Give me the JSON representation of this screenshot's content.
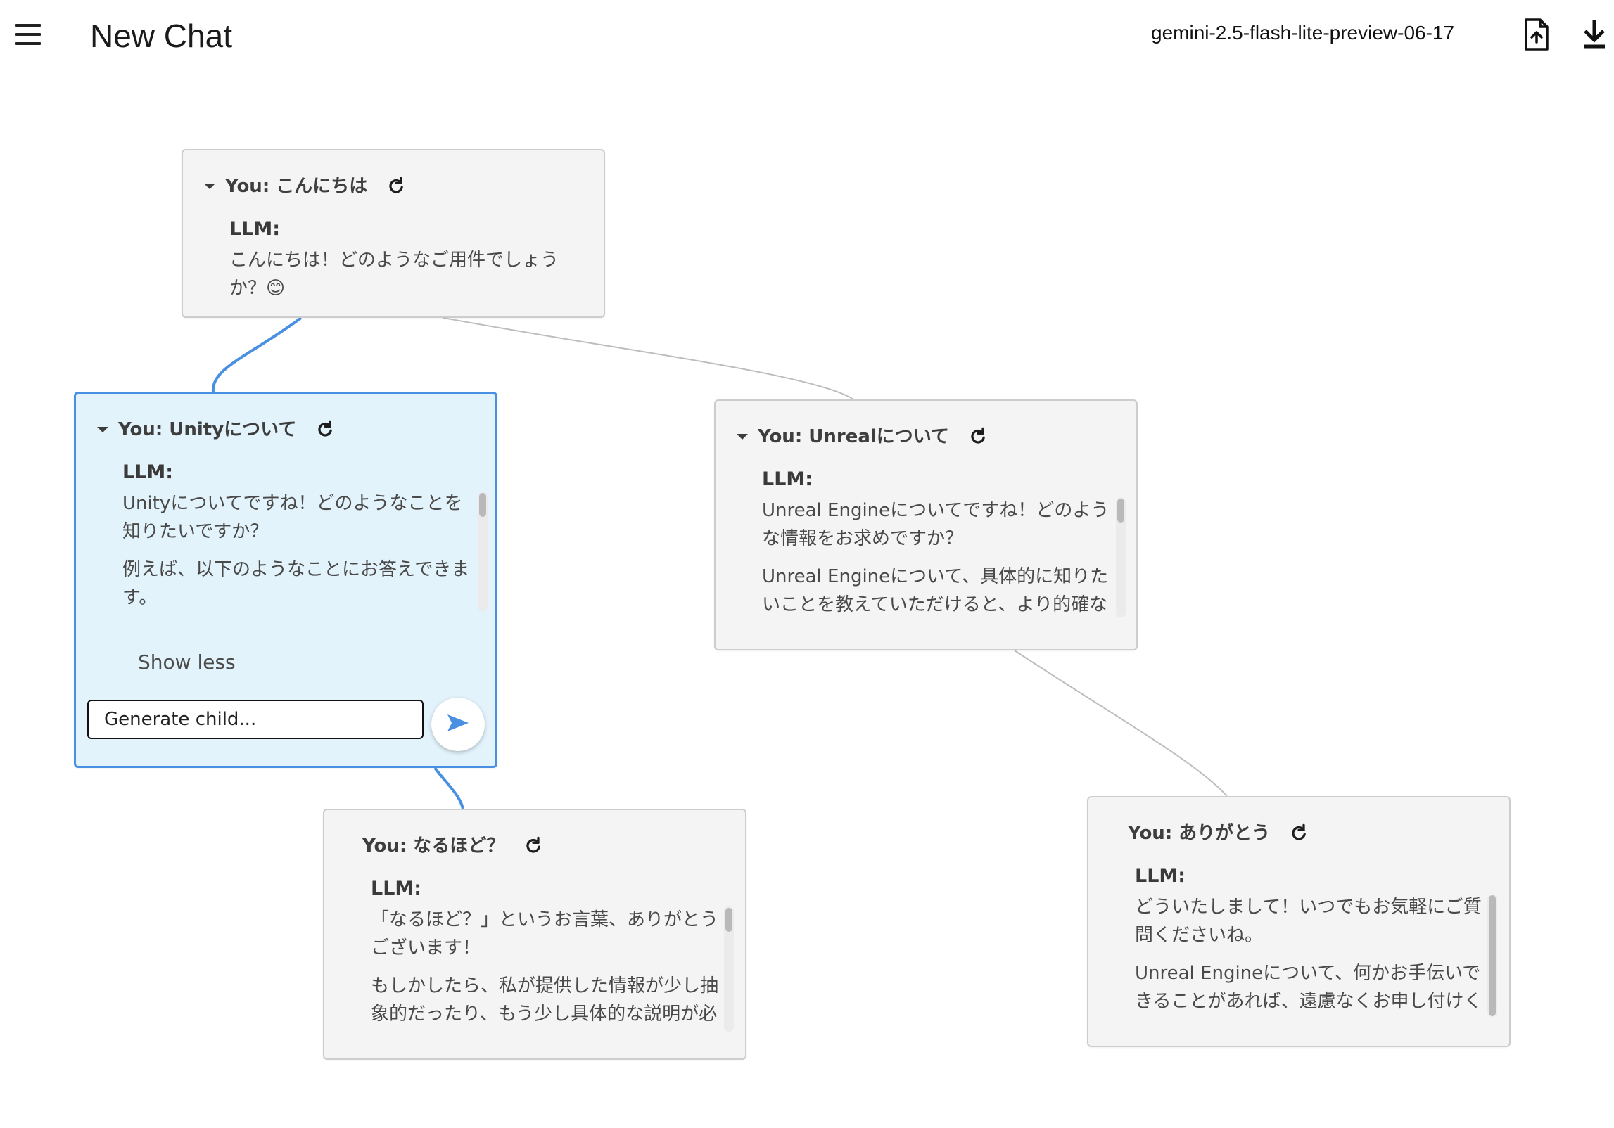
{
  "header": {
    "menu_icon": "menu-icon",
    "title": "New Chat",
    "model": "gemini-2.5-flash-lite-preview-06-17",
    "actions": [
      {
        "icon": "upload-file-icon"
      },
      {
        "icon": "download-icon"
      }
    ]
  },
  "nodes": [
    {
      "title": "You: こんにちは",
      "llm_label": "LLM:",
      "response": [
        "こんにちは！どのようなご用件でしょうか？😊"
      ],
      "collapsible": true,
      "selected": false
    },
    {
      "title": "You: Unityについて",
      "llm_label": "LLM:",
      "response": [
        "Unityについてですね！どのようなことを知りたいですか？",
        "例えば、以下のようなことにお答えできます。"
      ],
      "show_less_label": "Show less",
      "input_placeholder": "Generate child...",
      "send_icon": "send-icon",
      "collapsible": true,
      "selected": true
    },
    {
      "title": "You: Unrealについて",
      "llm_label": "LLM:",
      "response": [
        "Unreal Engineについてですね！どのような情報をお求めですか？",
        "Unreal Engineについて、具体的に知りたいことを教えていただけると、より的確な情報を提供できます。例えば、以下のよう"
      ],
      "collapsible": true,
      "selected": false
    },
    {
      "title": "You: なるほど？",
      "llm_label": "LLM:",
      "response": [
        "「なるほど？」というお言葉、ありがとうございます！",
        "もしかしたら、私が提供した情報が少し抽象的だったり、もう少し具体的な説明が必要だと感じられたのかもしれません。"
      ],
      "collapsible": false,
      "selected": false
    },
    {
      "title": "You: ありがとう",
      "llm_label": "LLM:",
      "response": [
        "どういたしまして！いつでもお気軽にご質問くださいね。",
        "Unreal Engineについて、何かお手伝いできることがあれば、遠慮なくお申し付けください。"
      ],
      "collapsible": false,
      "selected": false
    }
  ],
  "colors": {
    "selected_border": "#4a90e2",
    "selected_background": "#e3f3fb",
    "node_background": "#f4f4f4",
    "connector": "#bdbdbd",
    "selected_connector": "#4a90e2"
  }
}
